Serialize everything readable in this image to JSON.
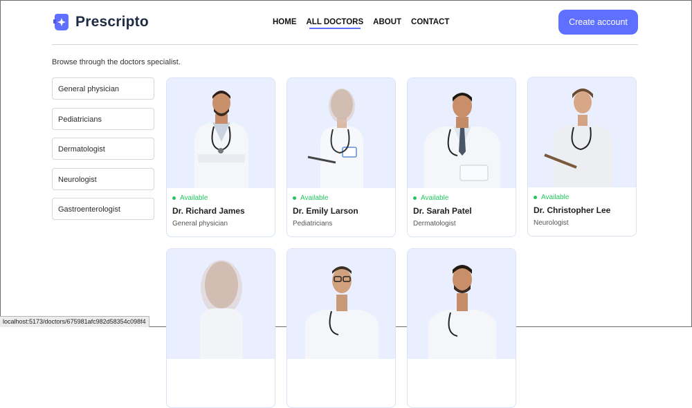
{
  "brand": {
    "name": "Prescripto",
    "accent": "#5f6fff"
  },
  "nav": {
    "items": [
      "HOME",
      "ALL DOCTORS",
      "ABOUT",
      "CONTACT"
    ],
    "active": "ALL DOCTORS"
  },
  "cta": {
    "label": "Create account"
  },
  "intro": "Browse through the doctors specialist.",
  "specialities": [
    "General physician",
    "Pediatricians",
    "Dermatologist",
    "Neurologist",
    "Gastroenterologist"
  ],
  "doctors": [
    {
      "name": "Dr. Richard James",
      "speciality": "General physician",
      "status": "Available"
    },
    {
      "name": "Dr. Emily Larson",
      "speciality": "Pediatricians",
      "status": "Available"
    },
    {
      "name": "Dr. Sarah Patel",
      "speciality": "Dermatologist",
      "status": "Available"
    },
    {
      "name": "Dr. Christopher Lee",
      "speciality": "Neurologist",
      "status": "Available"
    },
    {
      "name": "",
      "speciality": "",
      "status": ""
    },
    {
      "name": "",
      "speciality": "",
      "status": ""
    },
    {
      "name": "",
      "speciality": "",
      "status": ""
    }
  ],
  "status_bar": "localhost:5173/doctors/675981afc982d58354c098f4",
  "colors": {
    "available": "#22c55e",
    "card_bg": "#eaefff"
  }
}
